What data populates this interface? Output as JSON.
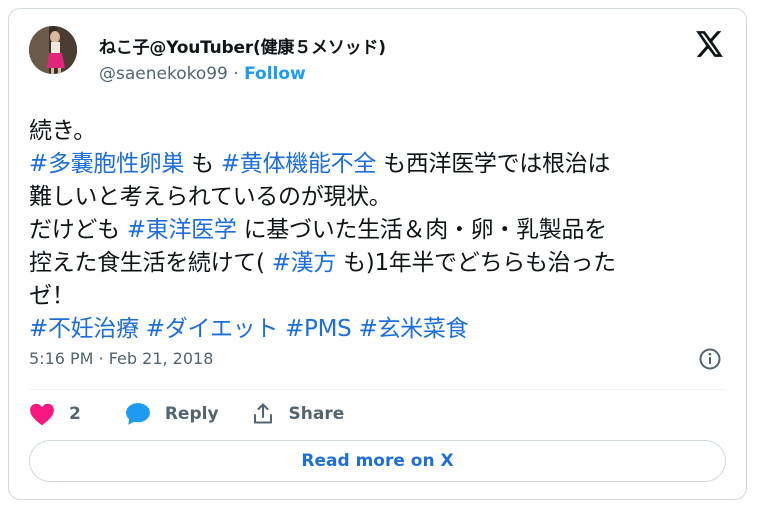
{
  "author": {
    "display_name": "ねこ子@YouTuber(健康５メソッド)",
    "handle": "@saenekoko99",
    "separator": " · ",
    "follow_label": "Follow"
  },
  "tweet": {
    "lines": [
      [
        {
          "text": "続き。",
          "tag": false
        }
      ],
      [
        {
          "text": "#多嚢胞性卵巣",
          "tag": true
        },
        {
          "text": " も ",
          "tag": false
        },
        {
          "text": "#黄体機能不全",
          "tag": true
        },
        {
          "text": " も西洋医学では根治は",
          "tag": false
        }
      ],
      [
        {
          "text": "難しいと考えられているのが現状。",
          "tag": false
        }
      ],
      [
        {
          "text": "だけども ",
          "tag": false
        },
        {
          "text": "#東洋医学",
          "tag": true
        },
        {
          "text": " に基づいた生活＆肉・卵・乳製品を",
          "tag": false
        }
      ],
      [
        {
          "text": "控えた食生活を続けて( ",
          "tag": false
        },
        {
          "text": "#漢方",
          "tag": true
        },
        {
          "text": " も)1年半でどちらも治った",
          "tag": false
        }
      ],
      [
        {
          "text": "ゼ！",
          "tag": false
        }
      ],
      [
        {
          "text": "#不妊治療",
          "tag": true
        },
        {
          "text": " ",
          "tag": false
        },
        {
          "text": "#ダイエット",
          "tag": true
        },
        {
          "text": " ",
          "tag": false
        },
        {
          "text": "#PMS",
          "tag": true
        },
        {
          "text": "  ",
          "tag": false
        },
        {
          "text": "#玄米菜食",
          "tag": true
        }
      ]
    ],
    "timestamp": "5:16 PM · Feb 21, 2018"
  },
  "actions": {
    "like_count": "2",
    "reply_label": "Reply",
    "share_label": "Share"
  },
  "read_more_label": "Read more on X",
  "colors": {
    "link": "#1d6ed8",
    "follow": "#1d9bf0",
    "like": "#f91880",
    "reply": "#1d9bf0",
    "muted": "#536471",
    "text": "#0f1419",
    "border": "#cfd9de"
  },
  "icons": [
    "avatar",
    "x-logo-icon",
    "info-icon",
    "heart-icon",
    "reply-bubble-icon",
    "share-icon"
  ]
}
